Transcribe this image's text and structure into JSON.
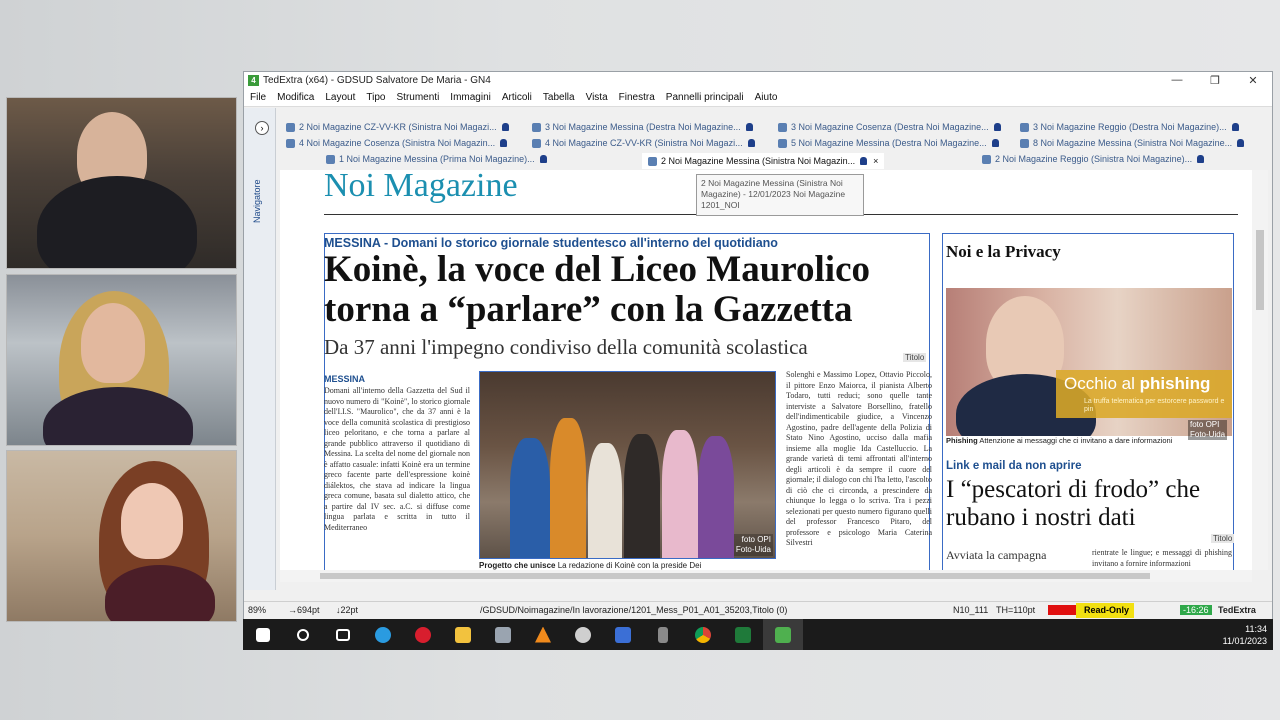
{
  "window": {
    "title": "TedExtra (x64) - GDSUD Salvatore De Maria - GN4",
    "controls": [
      "—",
      "❐",
      "✕"
    ]
  },
  "menu": [
    "File",
    "Modifica",
    "Layout",
    "Tipo",
    "Strumenti",
    "Immagini",
    "Articoli",
    "Tabella",
    "Vista",
    "Finestra",
    "Pannelli principali",
    "Aiuto"
  ],
  "navigator": {
    "label": "Navigatore"
  },
  "tabs": {
    "row1": [
      "2 Noi Magazine CZ-VV-KR (Sinistra Noi Magazi...",
      "3 Noi Magazine Messina (Destra Noi Magazine...",
      "3 Noi Magazine Cosenza (Destra Noi Magazine...",
      "3 Noi Magazine Reggio (Destra Noi Magazine)..."
    ],
    "row2": [
      "4 Noi Magazine Cosenza (Sinistra Noi Magazin...",
      "4 Noi Magazine CZ-VV-KR (Sinistra Noi Magazi...",
      "5 Noi Magazine Messina (Destra Noi Magazine...",
      "8 Noi Magazine Messina (Sinistra Noi Magazine..."
    ],
    "row3": [
      "1 Noi Magazine Messina (Prima Noi Magazine)...",
      "2 Noi Magazine Messina (Sinistra Noi Magazin...",
      "2 Noi Magazine Reggio (Sinistra Noi Magazine)..."
    ],
    "active_close": "×"
  },
  "tooltip": "2 Noi Magazine Messina (Sinistra Noi Magazine) - 12/01/2023 Noi Magazine 1201_NOI",
  "page": {
    "masthead": "Noi Magazine",
    "kicker": "MESSINA - Domani lo storico giornale studentesco all'interno del quotidiano",
    "headline": "Koinè, la voce del Liceo Maurolico torna a “parlare” con la Gazzetta",
    "subhead": "Da 37 anni l'impegno condiviso della comunità scolastica",
    "titolo_label": "Titolo",
    "col_kicker": "MESSINA",
    "col1": "Domani all'interno della Gazzetta del Sud il nuovo numero di \"Koinè\", lo storico giornale dell'I.I.S. \"Maurolico\", che da 37 anni è la voce della comunità scolastica di prestigioso liceo peloritano, e che torna a parlare al grande pubblico attraverso il quotidiano di Messina. La scelta del nome del giornale non è affatto casuale: infatti Koinè era un termine greco facente parte dell'espressione koinè diálektos, che stava ad indicare la lingua greca comune, basata sul dialetto attico, che a partire dal IV sec. a.C. si diffuse come lingua parlata e scritta in tutto il Mediterraneo",
    "col3": "Solenghi e Massimo Lopez, Ottavio Piccolo, il pittore Enzo Maiorca, il pianista Alberto Todaro, tutti reduci; sono quelle tante interviste a Salvatore Borsellino, fratello dell'indimenticabile giudice, a Vincenzo Agostino, padre dell'agente della Polizia di Stato Nino Agostino, ucciso dalla mafia insieme alla moglie Ida Castelluccio. La grande varietà di temi affrontati all'interno degli articoli è da sempre il cuore del giornale; il dialogo con chi l'ha letto, l'ascolto di ciò che ci circonda, a prescindere da chiunque lo legga o lo scriva. Tra i pezzi selezionati per questo numero figurano quelli del professor Francesco Pitaro, del professore e psicologo Maria Caterina Silvestri",
    "photo_credit": "foto OPI\nFoto-Uida",
    "caption_bold": "Progetto che unisce",
    "caption": " La redazione di Koinè con la preside Dei",
    "privacy_title": "Noi e la Privacy",
    "phish_prefix": "Occhio al ",
    "phish_bold": "phishing",
    "phish_sub": "La truffa telematica per estorcere password e pin",
    "privacy_caption_bold": "Phishing",
    "privacy_caption": " Attenzione ai messaggi che ci invitano a dare informazioni",
    "privacy_credit": "foto OPI\nFoto-Uida",
    "link_kicker": "Link e mail da non aprire",
    "right_head": "I “pescatori di frodo” che rubano i nostri dati",
    "right_sub": "Avviata la campagna",
    "right_col": "rientrate le lingue; e messaggi di phishing invitano a fornire informazioni"
  },
  "status": {
    "zoom": "89%",
    "x": "→694pt",
    "y": "↓22pt",
    "path": "/GDSUD/Noimagazine/In lavorazione/1201_Mess_P01_A01_35203,Titolo (0)",
    "style": "N10_111",
    "th": "TH=110pt",
    "error": "Error",
    "readonly": "Read-Only",
    "time": "-16:26",
    "app": "TedExtra"
  },
  "taskbar": {
    "time": "11:34",
    "date": "11/01/2023",
    "icons": [
      "windows-start",
      "search",
      "task-view",
      "edge",
      "opera",
      "file-explorer",
      "camera",
      "vlc",
      "settings",
      "paint",
      "usb",
      "chrome",
      "terminal",
      "tedextra"
    ]
  }
}
